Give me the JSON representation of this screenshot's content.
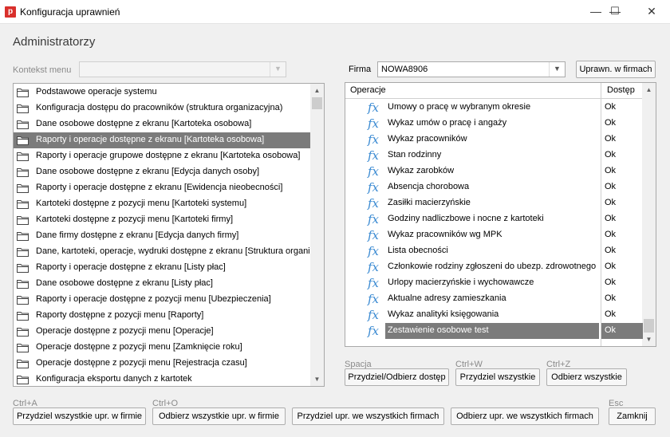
{
  "window": {
    "title": "Konfiguracja uprawnień",
    "icon_letter": "p"
  },
  "heading": "Administratorzy",
  "context_menu": {
    "label": "Kontekst menu",
    "value": ""
  },
  "firm": {
    "label": "Firma",
    "value": "NOWA8906",
    "button": "Uprawn. w firmach"
  },
  "tree_items": [
    "Podstawowe operacje systemu",
    "Konfiguracja dostępu do pracowników (struktura organizacyjna)",
    "Dane osobowe dostępne z ekranu [Kartoteka osobowa]",
    "Raporty i operacje dostępne z ekranu [Kartoteka osobowa]",
    "Raporty i operacje grupowe dostępne z ekranu [Kartoteka osobowa]",
    "Dane osobowe dostępne z ekranu [Edycja danych osoby]",
    "Raporty i operacje dostępne z ekranu [Ewidencja nieobecności]",
    "Kartoteki dostępne z pozycji menu [Kartoteki systemu]",
    "Kartoteki dostępne z pozycji menu [Kartoteki firmy]",
    "Dane firmy dostępne z ekranu [Edycja danych firmy]",
    "Dane, kartoteki, operacje, wydruki dostępne z ekranu [Struktura organiz",
    "Raporty i operacje dostępne z ekranu [Listy płac]",
    "Dane osobowe dostępne z ekranu [Listy płac]",
    "Raporty i operacje dostępne z pozycji menu [Ubezpieczenia]",
    "Raporty dostępne z pozycji menu [Raporty]",
    "Operacje dostępne z pozycji menu [Operacje]",
    "Operacje dostępne z pozycji menu [Zamknięcie roku]",
    "Operacje dostępne z pozycji menu [Rejestracja czasu]",
    "Konfiguracja eksportu danych z kartotek"
  ],
  "tree_selected_index": 3,
  "grid": {
    "col_operation": "Operacje",
    "col_access": "Dostęp",
    "rows": [
      {
        "name": "Umowy o pracę w wybranym okresie",
        "access": "Ok"
      },
      {
        "name": "Wykaz umów o pracę i angaży",
        "access": "Ok"
      },
      {
        "name": "Wykaz pracowników",
        "access": "Ok"
      },
      {
        "name": "Stan rodzinny",
        "access": "Ok"
      },
      {
        "name": "Wykaz zarobków",
        "access": "Ok"
      },
      {
        "name": "Absencja chorobowa",
        "access": "Ok"
      },
      {
        "name": "Zasiłki macierzyńskie",
        "access": "Ok"
      },
      {
        "name": "Godziny nadliczbowe i nocne z kartoteki",
        "access": "Ok"
      },
      {
        "name": "Wykaz pracowników wg MPK",
        "access": "Ok"
      },
      {
        "name": "Lista obecności",
        "access": "Ok"
      },
      {
        "name": "Członkowie rodziny zgłoszeni do ubezp. zdrowotnego",
        "access": "Ok"
      },
      {
        "name": "Urlopy macierzyńskie i wychowawcze",
        "access": "Ok"
      },
      {
        "name": "Aktualne adresy zamieszkania",
        "access": "Ok"
      },
      {
        "name": "Wykaz analityki księgowania",
        "access": "Ok"
      },
      {
        "name": "Zestawienie osobowe test",
        "access": "Ok"
      }
    ],
    "selected_index": 14,
    "fx_symbol": "fx"
  },
  "grid_buttons": [
    {
      "shortcut": "Spacja",
      "label": "Przydziel/Odbierz dostęp"
    },
    {
      "shortcut": "Ctrl+W",
      "label": "Przydziel wszystkie"
    },
    {
      "shortcut": "Ctrl+Z",
      "label": "Odbierz wszystkie"
    }
  ],
  "bottom_buttons": [
    {
      "shortcut": "Ctrl+A",
      "label": "Przydziel wszystkie upr. w firmie"
    },
    {
      "shortcut": "Ctrl+O",
      "label": "Odbierz wszystkie upr. w firmie"
    },
    {
      "shortcut": "",
      "label": "Przydziel upr. we wszystkich firmach"
    },
    {
      "shortcut": "",
      "label": "Odbierz upr. we wszystkich firmach"
    },
    {
      "shortcut": "Esc",
      "label": "Zamknij"
    }
  ]
}
